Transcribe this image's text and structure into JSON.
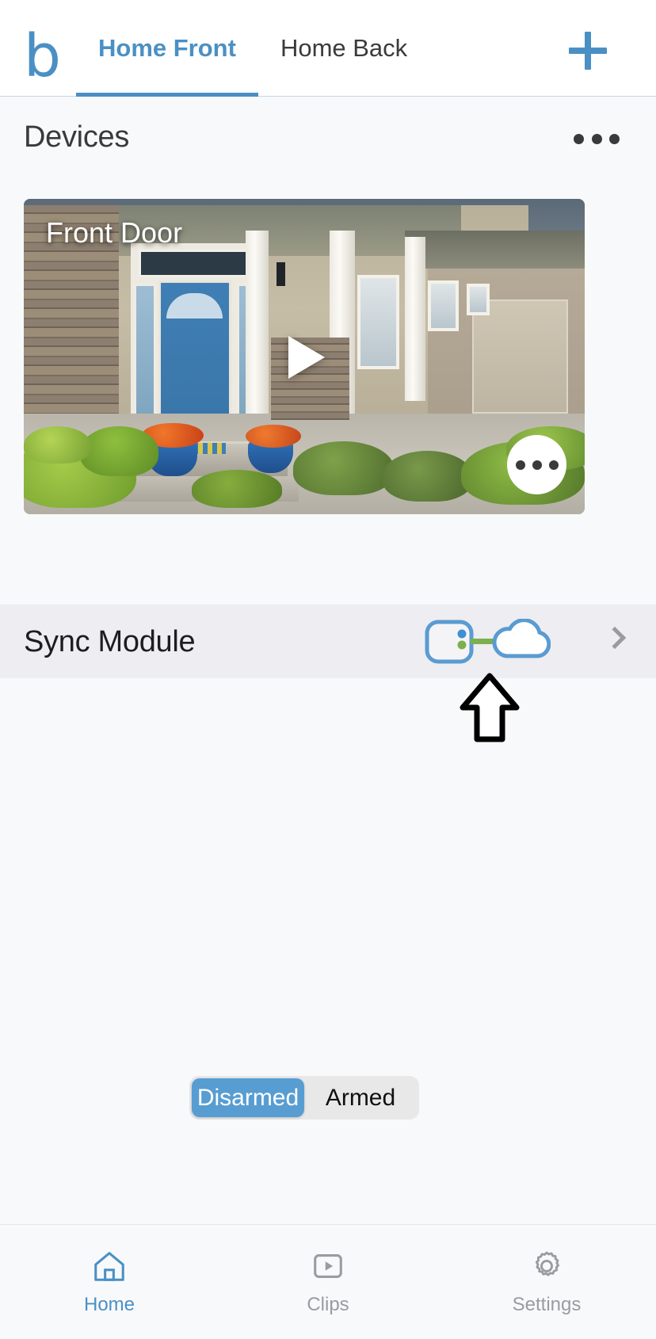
{
  "app": {
    "logo_text": "b",
    "logo_color": "#4a90c4"
  },
  "topbar": {
    "tabs": [
      {
        "label": "Home Front",
        "active": true
      },
      {
        "label": "Home Back",
        "active": false
      }
    ],
    "add_label": "+",
    "add_icon": "plus-icon"
  },
  "devices": {
    "title": "Devices",
    "overflow_icon": "more-horizontal-icon"
  },
  "camera": {
    "name": "Front Door",
    "play_icon": "play-icon",
    "more_icon": "more-horizontal-icon"
  },
  "sync": {
    "title": "Sync Module",
    "status_icon": "sync-module-cloud-connected-icon",
    "chevron_icon": "chevron-right-icon",
    "module_color": "#5a9bd1",
    "link_color": "#7cb04e",
    "led_blue": "#3f8fd1",
    "led_green": "#7cb04e"
  },
  "annotation": {
    "arrow_icon": "up-arrow-annotation-icon",
    "color": "#000000"
  },
  "arm_toggle": {
    "options": [
      {
        "label": "Disarmed",
        "selected": true
      },
      {
        "label": "Armed",
        "selected": false
      }
    ],
    "active_color": "#589dd1"
  },
  "bottom_nav": {
    "items": [
      {
        "label": "Home",
        "icon": "home-icon",
        "active": true
      },
      {
        "label": "Clips",
        "icon": "clips-play-icon",
        "active": false
      },
      {
        "label": "Settings",
        "icon": "gear-icon",
        "active": false
      }
    ],
    "active_color": "#4a90c4",
    "inactive_color": "#9b9ba0"
  }
}
